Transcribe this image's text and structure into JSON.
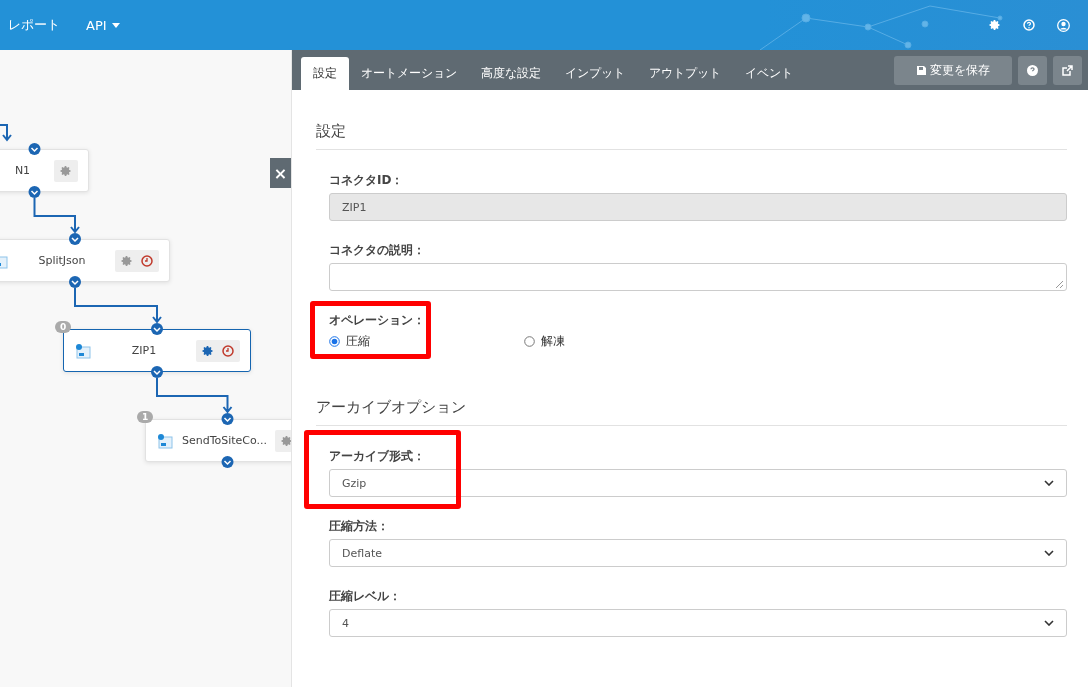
{
  "top_nav": {
    "items": [
      {
        "label": "レポート",
        "dropdown": false
      },
      {
        "label": "API",
        "dropdown": true
      }
    ]
  },
  "canvas": {
    "close": "×",
    "nodes": [
      {
        "name": "N1",
        "selected": false,
        "schedule": false
      },
      {
        "name": "SplitJson",
        "selected": false,
        "schedule": true
      },
      {
        "name": "ZIP1",
        "badge": "0",
        "selected": true,
        "schedule": true
      },
      {
        "name": "SendToSiteCo...",
        "badge": "1",
        "selected": false,
        "schedule": false
      }
    ]
  },
  "tabs": [
    {
      "label": "設定",
      "selected": true
    },
    {
      "label": "オートメーション",
      "selected": false
    },
    {
      "label": "高度な設定",
      "selected": false
    },
    {
      "label": "インプット",
      "selected": false
    },
    {
      "label": "アウトプット",
      "selected": false
    },
    {
      "label": "イベント",
      "selected": false
    }
  ],
  "save_button": "変更を保存",
  "sections": [
    {
      "title": "設定",
      "fields": [
        {
          "kind": "text",
          "label": "コネクタID：",
          "value": "ZIP1",
          "disabled": true,
          "highlighted": false
        },
        {
          "kind": "textarea",
          "label": "コネクタの説明：",
          "disabled": false,
          "highlighted": false
        },
        {
          "kind": "radio",
          "label": "オペレーション：",
          "highlighted": true,
          "options": [
            {
              "label": "圧縮",
              "selected": true
            },
            {
              "label": "解凍",
              "selected": false
            }
          ]
        }
      ]
    },
    {
      "title": "アーカイブオプション",
      "fields": [
        {
          "kind": "select",
          "label": "アーカイブ形式：",
          "value": "Gzip",
          "disabled": false,
          "highlighted": true
        },
        {
          "kind": "select",
          "label": "圧縮方法：",
          "value": "Deflate",
          "disabled": false,
          "highlighted": false
        },
        {
          "kind": "select",
          "label": "圧縮レベル：",
          "value": "4",
          "disabled": false,
          "highlighted": false
        }
      ]
    }
  ]
}
